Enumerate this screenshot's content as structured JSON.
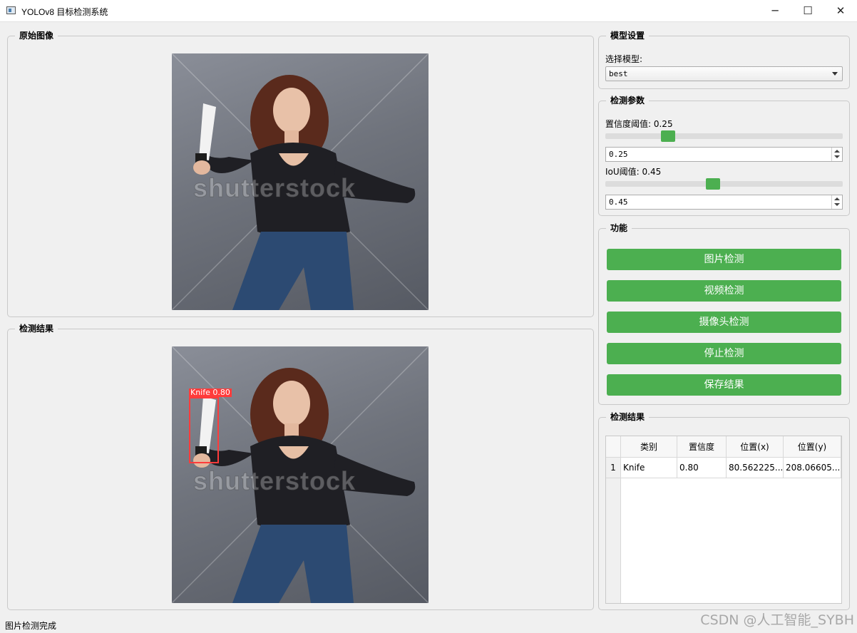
{
  "window": {
    "title": "YOLOv8 目标检测系统",
    "minimize": "─",
    "maximize": "☐",
    "close": "✕"
  },
  "original": {
    "group_title": "原始图像",
    "watermark": "shutterstock"
  },
  "result": {
    "group_title": "检测结果",
    "watermark": "shutterstock",
    "detection_label": "Knife 0.80"
  },
  "model": {
    "group_title": "模型设置",
    "select_label": "选择模型:",
    "selected": "best"
  },
  "params": {
    "group_title": "检测参数",
    "conf_label": "置信度阈值: 0.25",
    "conf_value": "0.25",
    "conf_fraction": 0.25,
    "iou_label": "IoU阈值: 0.45",
    "iou_value": "0.45",
    "iou_fraction": 0.45
  },
  "functions": {
    "group_title": "功能",
    "buttons": [
      "图片检测",
      "视频检测",
      "摄像头检测",
      "停止检测",
      "保存结果"
    ]
  },
  "results_table": {
    "group_title": "检测结果",
    "headers": [
      "类别",
      "置信度",
      "位置(x)",
      "位置(y)"
    ],
    "rows": [
      {
        "index": "1",
        "class": "Knife",
        "conf": "0.80",
        "x": "80.562225...",
        "y": "208.06605..."
      }
    ]
  },
  "status_bar": "图片检测完成",
  "watermark_text": "CSDN @人工智能_SYBH",
  "colors": {
    "accent_green": "#4caf50",
    "detection_red": "#ff3b3b"
  }
}
